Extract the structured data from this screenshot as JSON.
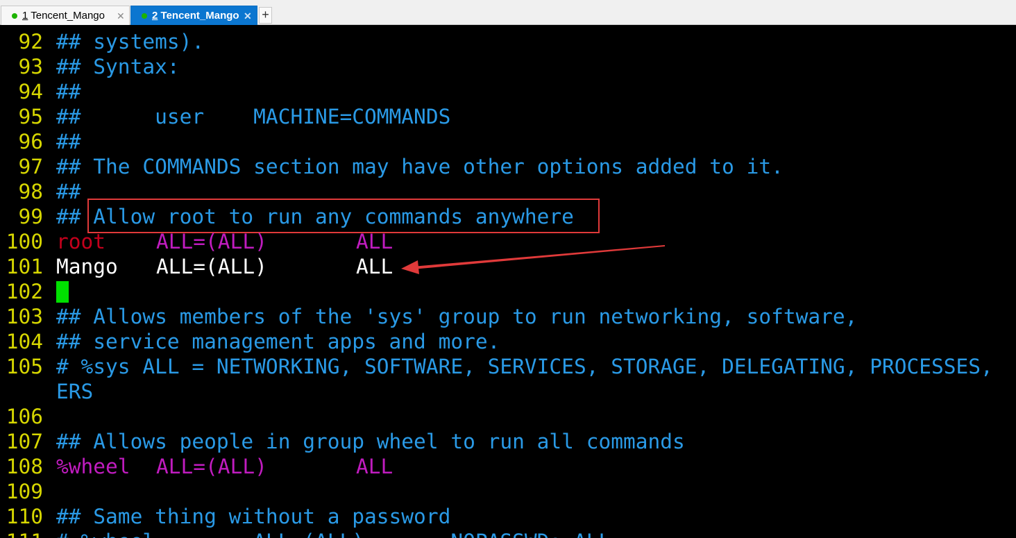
{
  "tabs": [
    {
      "number": "1",
      "title": "Tencent_Mango",
      "close": "✕",
      "status_color": "#1db300"
    },
    {
      "number": "2",
      "title": "Tencent_Mango",
      "close": "✕",
      "status_color": "#1db300"
    }
  ],
  "new_tab_label": "+",
  "colors": {
    "comment": "#2a9ae6",
    "line_number": "#d7d700",
    "user_root": "#c4001c",
    "keyword": "#c01cbf",
    "cursor": "#00e000",
    "annotation": "#e03a3a"
  },
  "lines": [
    {
      "n": "92",
      "text": "## systems)."
    },
    {
      "n": "93",
      "text": "## Syntax:"
    },
    {
      "n": "94",
      "text": "##"
    },
    {
      "n": "95",
      "text": "##      user    MACHINE=COMMANDS"
    },
    {
      "n": "96",
      "text": "##"
    },
    {
      "n": "97",
      "text": "## The COMMANDS section may have other options added to it."
    },
    {
      "n": "98",
      "text": "##"
    },
    {
      "n": "99",
      "text": "## Allow root to run any commands anywhere"
    },
    {
      "n": "100",
      "user": "root",
      "spec": "ALL=(ALL)",
      "cmd": "ALL"
    },
    {
      "n": "101",
      "user": "Mango",
      "spec": "ALL=(ALL)",
      "cmd": "ALL"
    },
    {
      "n": "102",
      "text": ""
    },
    {
      "n": "103",
      "text": "## Allows members of the 'sys' group to run networking, software,"
    },
    {
      "n": "104",
      "text": "## service management apps and more."
    },
    {
      "n": "105",
      "text": "# %sys ALL = NETWORKING, SOFTWARE, SERVICES, STORAGE, DELEGATING, PROCESSES,"
    },
    {
      "n": "",
      "text": "ERS"
    },
    {
      "n": "106",
      "text": ""
    },
    {
      "n": "107",
      "text": "## Allows people in group wheel to run all commands"
    },
    {
      "n": "108",
      "user": "%wheel",
      "spec": "ALL=(ALL)",
      "cmd": "ALL"
    },
    {
      "n": "109",
      "text": ""
    },
    {
      "n": "110",
      "text": "## Same thing without a password"
    },
    {
      "n": "111",
      "text": "# %wheel        ALL=(ALL)       NOPASSWD: ALL"
    }
  ]
}
